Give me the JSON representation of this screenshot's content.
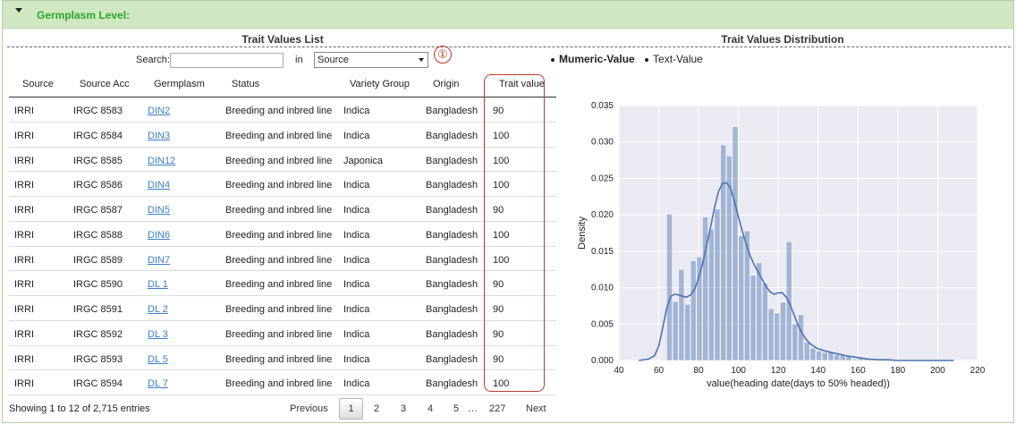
{
  "header": {
    "title": "Germplasm Level:"
  },
  "left_panel": {
    "title": "Trait Values List",
    "search_label": "Search:",
    "search_value": "",
    "in_label": "in",
    "select_value": "Source",
    "annotation_marker": "①"
  },
  "table": {
    "columns": [
      "Source",
      "Source Acc",
      "Germplasm",
      "Status",
      "Variety Group",
      "Origin",
      "Trait value"
    ],
    "rows": [
      [
        "IRRI",
        "IRGC 8583",
        "DIN2",
        "Breeding and inbred line",
        "Indica",
        "Bangladesh",
        "90"
      ],
      [
        "IRRI",
        "IRGC 8584",
        "DIN3",
        "Breeding and inbred line",
        "Indica",
        "Bangladesh",
        "100"
      ],
      [
        "IRRI",
        "IRGC 8585",
        "DIN12",
        "Breeding and inbred line",
        "Japonica",
        "Bangladesh",
        "100"
      ],
      [
        "IRRI",
        "IRGC 8586",
        "DIN4",
        "Breeding and inbred line",
        "Indica",
        "Bangladesh",
        "100"
      ],
      [
        "IRRI",
        "IRGC 8587",
        "DIN5",
        "Breeding and inbred line",
        "Indica",
        "Bangladesh",
        "90"
      ],
      [
        "IRRI",
        "IRGC 8588",
        "DIN6",
        "Breeding and inbred line",
        "Indica",
        "Bangladesh",
        "100"
      ],
      [
        "IRRI",
        "IRGC 8589",
        "DIN7",
        "Breeding and inbred line",
        "Indica",
        "Bangladesh",
        "100"
      ],
      [
        "IRRI",
        "IRGC 8590",
        "DL 1",
        "Breeding and inbred line",
        "Indica",
        "Bangladesh",
        "90"
      ],
      [
        "IRRI",
        "IRGC 8591",
        "DL 2",
        "Breeding and inbred line",
        "Indica",
        "Bangladesh",
        "90"
      ],
      [
        "IRRI",
        "IRGC 8592",
        "DL 3",
        "Breeding and inbred line",
        "Indica",
        "Bangladesh",
        "90"
      ],
      [
        "IRRI",
        "IRGC 8593",
        "DL 5",
        "Breeding and inbred line",
        "Indica",
        "Bangladesh",
        "90"
      ],
      [
        "IRRI",
        "IRGC 8594",
        "DL 7",
        "Breeding and inbred line",
        "Indica",
        "Bangladesh",
        "100"
      ]
    ]
  },
  "footer": {
    "info": "Showing 1 to 12 of 2,715 entries",
    "previous": "Previous",
    "pages": [
      "1",
      "2",
      "3",
      "4",
      "5"
    ],
    "ellipsis": "…",
    "last_page": "227",
    "next": "Next"
  },
  "right_panel": {
    "title": "Trait Values Distribution",
    "options": [
      {
        "label": "Mumeric-Value",
        "selected": true
      },
      {
        "label": "Text-Value",
        "selected": false
      }
    ]
  },
  "colors": {
    "header_bg": "#cfe8c1",
    "header_text": "#2aa62a",
    "link": "#3a7fc8",
    "highlight": "#c0392b",
    "plot_bg": "#eaeaf2",
    "bar_fill": "#4c72b0"
  },
  "chart_data": {
    "type": "bar",
    "xlabel": "value(heading date(days to 50% headed))",
    "ylabel": "Density",
    "xlim": [
      40,
      220
    ],
    "ylim": [
      0,
      0.035
    ],
    "xticks": [
      40,
      60,
      80,
      100,
      120,
      140,
      160,
      180,
      200,
      220
    ],
    "yticks": [
      "0.000",
      "0.005",
      "0.010",
      "0.015",
      "0.020",
      "0.025",
      "0.030",
      "0.035"
    ],
    "grid": true,
    "bin_width": 3,
    "bins": [
      [
        61,
        0.0001
      ],
      [
        64,
        0.0201
      ],
      [
        67,
        0.0081
      ],
      [
        70,
        0.0125
      ],
      [
        73,
        0.0077
      ],
      [
        76,
        0.0137
      ],
      [
        79,
        0.0142
      ],
      [
        82,
        0.0197
      ],
      [
        85,
        0.018
      ],
      [
        88,
        0.0208
      ],
      [
        91,
        0.0296
      ],
      [
        94,
        0.0281
      ],
      [
        97,
        0.0321
      ],
      [
        100,
        0.0171
      ],
      [
        103,
        0.0178
      ],
      [
        106,
        0.0117
      ],
      [
        109,
        0.0134
      ],
      [
        112,
        0.0106
      ],
      [
        115,
        0.0071
      ],
      [
        118,
        0.0065
      ],
      [
        121,
        0.008
      ],
      [
        124,
        0.0163
      ],
      [
        127,
        0.005
      ],
      [
        130,
        0.0063
      ],
      [
        133,
        0.0025
      ],
      [
        136,
        0.0017
      ],
      [
        139,
        0.0013
      ],
      [
        142,
        0.0011
      ],
      [
        145,
        0.0011
      ],
      [
        148,
        0.0008
      ],
      [
        151,
        0.0008
      ],
      [
        154,
        0.0006
      ],
      [
        157,
        0.0002
      ],
      [
        160,
        0.0003
      ],
      [
        163,
        0.0002
      ],
      [
        166,
        0.0001
      ]
    ],
    "kde": {
      "x": [
        50,
        55,
        58,
        60,
        62,
        64,
        66,
        68,
        70,
        72,
        74,
        76,
        78,
        80,
        82,
        84,
        86,
        88,
        90,
        92,
        94,
        96,
        98,
        100,
        102,
        104,
        106,
        108,
        110,
        112,
        114,
        116,
        118,
        120,
        122,
        124,
        126,
        128,
        130,
        132,
        134,
        136,
        138,
        140,
        145,
        150,
        155,
        160,
        165,
        170,
        175,
        180,
        190,
        200,
        208
      ],
      "y": [
        0.0,
        0.0002,
        0.0007,
        0.002,
        0.0045,
        0.0072,
        0.0088,
        0.0091,
        0.009,
        0.0088,
        0.0087,
        0.009,
        0.0098,
        0.0113,
        0.0133,
        0.0158,
        0.0183,
        0.021,
        0.0232,
        0.0243,
        0.0244,
        0.0237,
        0.0218,
        0.0197,
        0.0177,
        0.0158,
        0.0143,
        0.0131,
        0.0121,
        0.0111,
        0.0101,
        0.0094,
        0.0091,
        0.0093,
        0.0093,
        0.0087,
        0.0076,
        0.0062,
        0.0048,
        0.0037,
        0.0029,
        0.0023,
        0.0019,
        0.0016,
        0.0012,
        0.0009,
        0.0006,
        0.0004,
        0.0002,
        0.0001,
        0.0001,
        0.0,
        0.0,
        0.0,
        0.0
      ]
    }
  }
}
